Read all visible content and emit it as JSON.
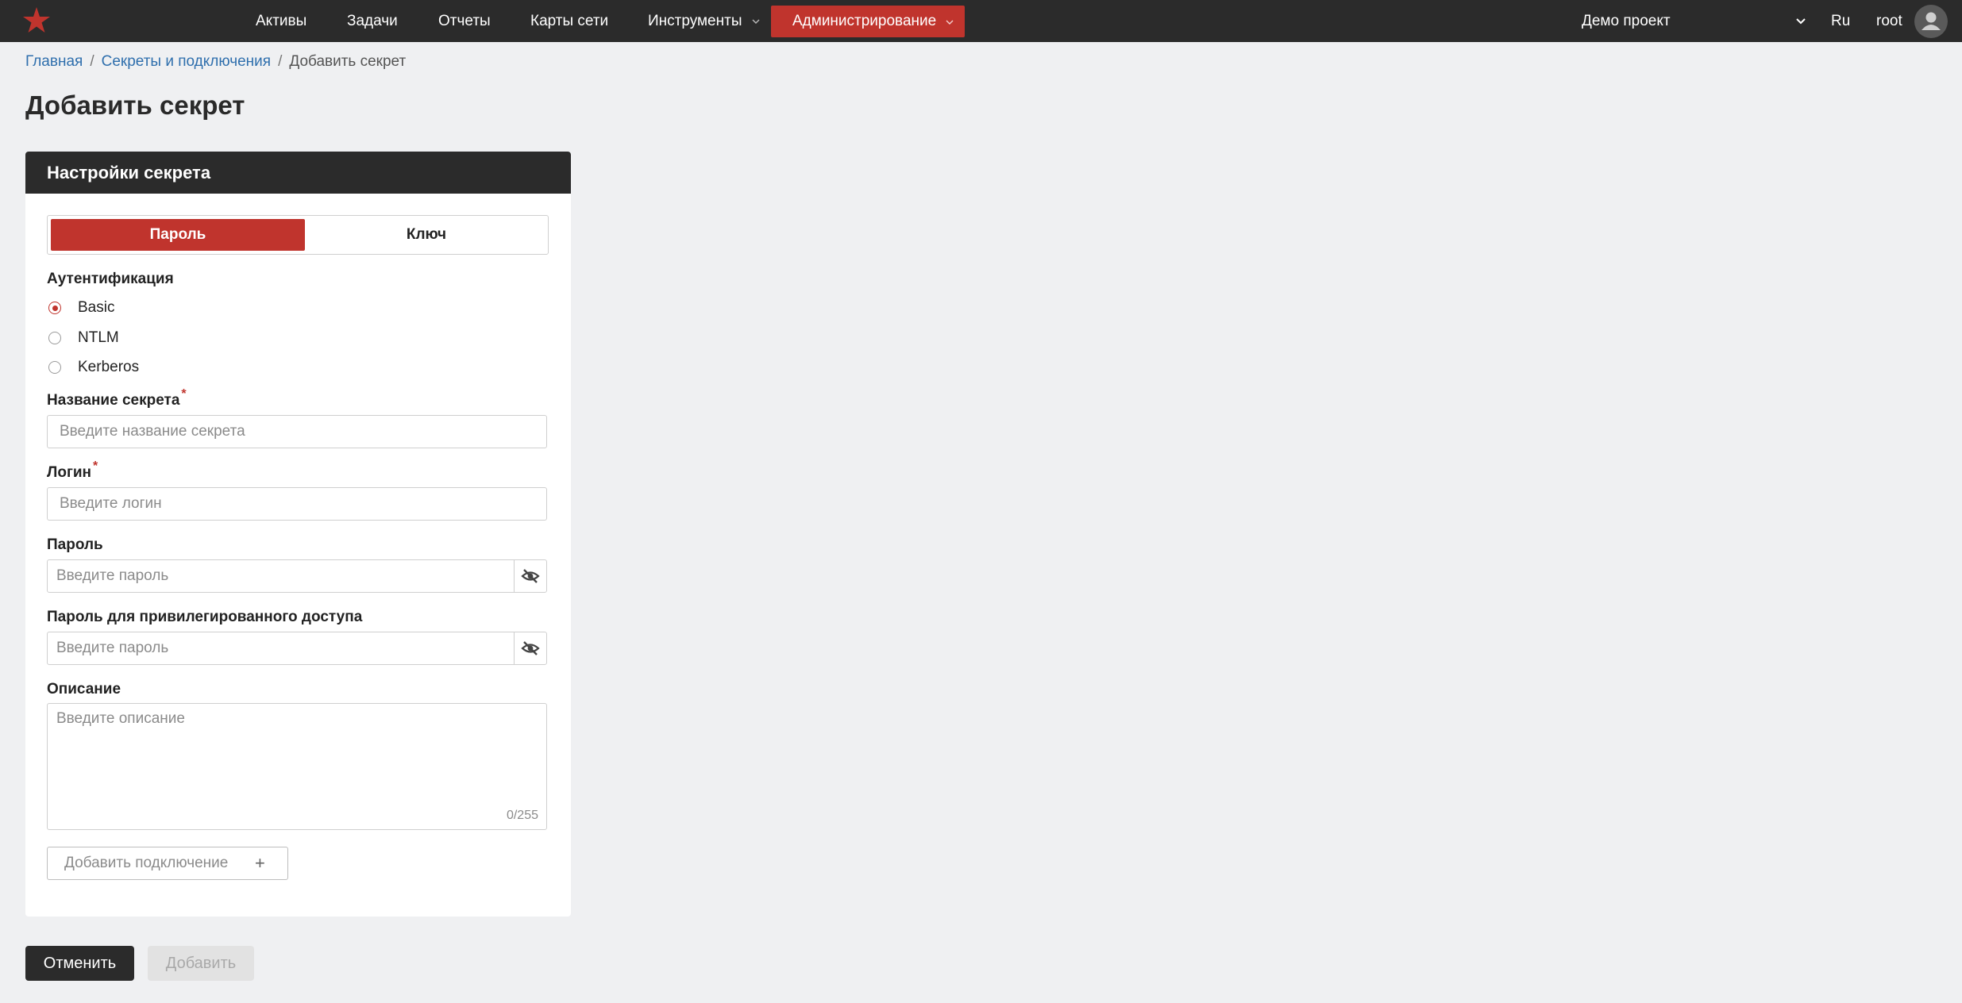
{
  "nav": {
    "items": [
      "Активы",
      "Задачи",
      "Отчеты",
      "Карты сети",
      "Инструменты",
      "Администрирование"
    ],
    "active_item": "Администрирование",
    "project": "Демо проект",
    "lang": "Ru",
    "user": "root",
    "accent_color": "#c0342d"
  },
  "breadcrumb": {
    "home": "Главная",
    "section": "Секреты и подключения",
    "current": "Добавить секрет",
    "separator": "/"
  },
  "page": {
    "title": "Добавить секрет"
  },
  "card": {
    "header": "Настройки секрета",
    "tabs": {
      "password": "Пароль",
      "key": "Ключ",
      "selected": "Пароль"
    },
    "auth": {
      "label": "Аутентификация",
      "options": [
        "Basic",
        "NTLM",
        "Kerberos"
      ],
      "selected": "Basic"
    },
    "secret_name": {
      "label": "Название секрета",
      "required_mark": "*",
      "placeholder": "Введите название секрета",
      "value": ""
    },
    "login": {
      "label": "Логин",
      "required_mark": "*",
      "placeholder": "Введите логин",
      "value": ""
    },
    "password": {
      "label": "Пароль",
      "placeholder": "Введите пароль",
      "value": ""
    },
    "priv_password": {
      "label": "Пароль для привилегированного доступа",
      "placeholder": "Введите пароль",
      "value": ""
    },
    "description": {
      "label": "Описание",
      "placeholder": "Введите описание",
      "value": "",
      "counter": "0/255"
    },
    "add_connection": {
      "label": "Добавить подключение",
      "icon": "plus-icon"
    }
  },
  "actions": {
    "cancel": "Отменить",
    "submit": "Добавить"
  }
}
